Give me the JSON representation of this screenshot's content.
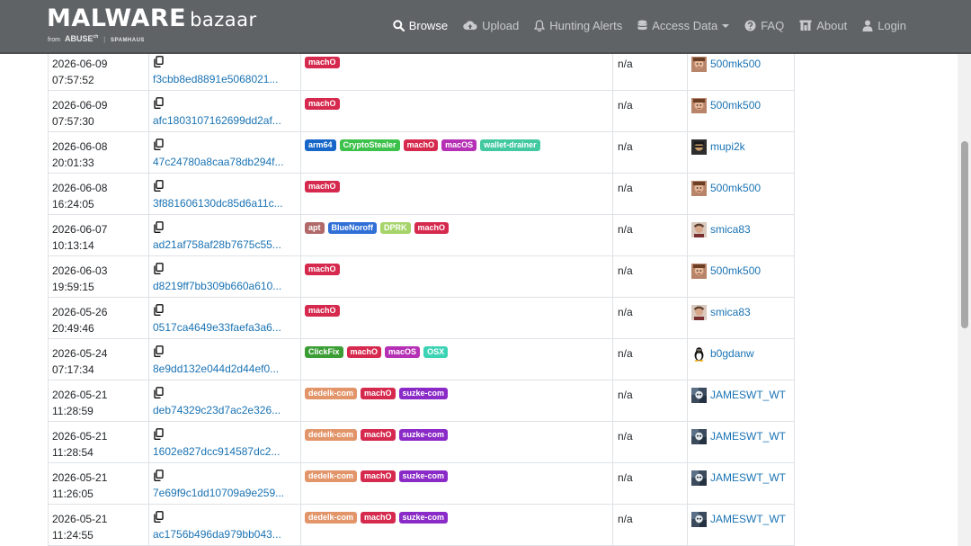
{
  "brand": {
    "name": "MALWARE",
    "sub": "bazaar",
    "from": "from",
    "abuse": "ABUSE",
    "abuse_suffix": "ch",
    "spamhaus": "SPAMHAUS"
  },
  "nav": {
    "browse": "Browse",
    "upload": "Upload",
    "hunting": "Hunting Alerts",
    "access": "Access Data",
    "faq": "FAQ",
    "about": "About",
    "login": "Login"
  },
  "tag_colors": {
    "machO": "#d6294e",
    "arm64": "#1667c9",
    "CryptoStealer": "#3cc14a",
    "macOS": "#b530b5",
    "wallet-drainer": "#43c9a0",
    "apt": "#b06a6a",
    "BlueNoroff": "#2f6fd6",
    "DPRK": "#a6d46a",
    "ClickFix": "#3b9e35",
    "OSX": "#3cd3b5",
    "dedelk-com": "#e3956a",
    "suzke-com": "#8a2ac7"
  },
  "rows": [
    {
      "date": "2026-06-09",
      "time": "07:57:52",
      "hash": "f3cbb8ed8891e5068021...",
      "tags": [
        "machO"
      ],
      "signature": "n/a",
      "reporter": "500mk500",
      "avatar": "face-avatar"
    },
    {
      "date": "2026-06-09",
      "time": "07:57:30",
      "hash": "afc1803107162699dd2af...",
      "tags": [
        "machO"
      ],
      "signature": "n/a",
      "reporter": "500mk500",
      "avatar": "face-avatar"
    },
    {
      "date": "2026-06-08",
      "time": "20:01:33",
      "hash": "47c24780a8caa78db294f...",
      "tags": [
        "arm64",
        "CryptoStealer",
        "machO",
        "macOS",
        "wallet-drainer"
      ],
      "signature": "n/a",
      "reporter": "mupi2k",
      "avatar": "dark-avatar"
    },
    {
      "date": "2026-06-08",
      "time": "16:24:05",
      "hash": "3f881606130dc85d6a11c...",
      "tags": [
        "machO"
      ],
      "signature": "n/a",
      "reporter": "500mk500",
      "avatar": "face-avatar"
    },
    {
      "date": "2026-06-07",
      "time": "10:13:14",
      "hash": "ad21af758af28b7675c55...",
      "tags": [
        "apt",
        "BlueNoroff",
        "DPRK",
        "machO"
      ],
      "signature": "n/a",
      "reporter": "smica83",
      "avatar": "person-avatar"
    },
    {
      "date": "2026-06-03",
      "time": "19:59:15",
      "hash": "d8219ff7bb309b660a610...",
      "tags": [
        "machO"
      ],
      "signature": "n/a",
      "reporter": "500mk500",
      "avatar": "face-avatar"
    },
    {
      "date": "2026-05-26",
      "time": "20:49:46",
      "hash": "0517ca4649e33faefa3a6...",
      "tags": [
        "machO"
      ],
      "signature": "n/a",
      "reporter": "smica83",
      "avatar": "person-avatar"
    },
    {
      "date": "2026-05-24",
      "time": "07:17:34",
      "hash": "8e9dd132e044d2d44ef0...",
      "tags": [
        "ClickFix",
        "machO",
        "macOS",
        "OSX"
      ],
      "signature": "n/a",
      "reporter": "b0gdanw",
      "avatar": "penguin-avatar"
    },
    {
      "date": "2026-05-21",
      "time": "11:28:59",
      "hash": "deb74329c23d7ac2e326...",
      "tags": [
        "dedelk-com",
        "machO",
        "suzke-com"
      ],
      "signature": "n/a",
      "reporter": "JAMESWT_WT",
      "avatar": "skull-avatar"
    },
    {
      "date": "2026-05-21",
      "time": "11:28:54",
      "hash": "1602e827dcc914587dc2...",
      "tags": [
        "dedelk-com",
        "machO",
        "suzke-com"
      ],
      "signature": "n/a",
      "reporter": "JAMESWT_WT",
      "avatar": "skull-avatar"
    },
    {
      "date": "2026-05-21",
      "time": "11:26:05",
      "hash": "7e69f9c1dd10709a9e259...",
      "tags": [
        "dedelk-com",
        "machO",
        "suzke-com"
      ],
      "signature": "n/a",
      "reporter": "JAMESWT_WT",
      "avatar": "skull-avatar"
    },
    {
      "date": "2026-05-21",
      "time": "11:24:55",
      "hash": "ac1756b496da979bb043...",
      "tags": [
        "dedelk-com",
        "machO",
        "suzke-com"
      ],
      "signature": "n/a",
      "reporter": "JAMESWT_WT",
      "avatar": "skull-avatar"
    }
  ]
}
